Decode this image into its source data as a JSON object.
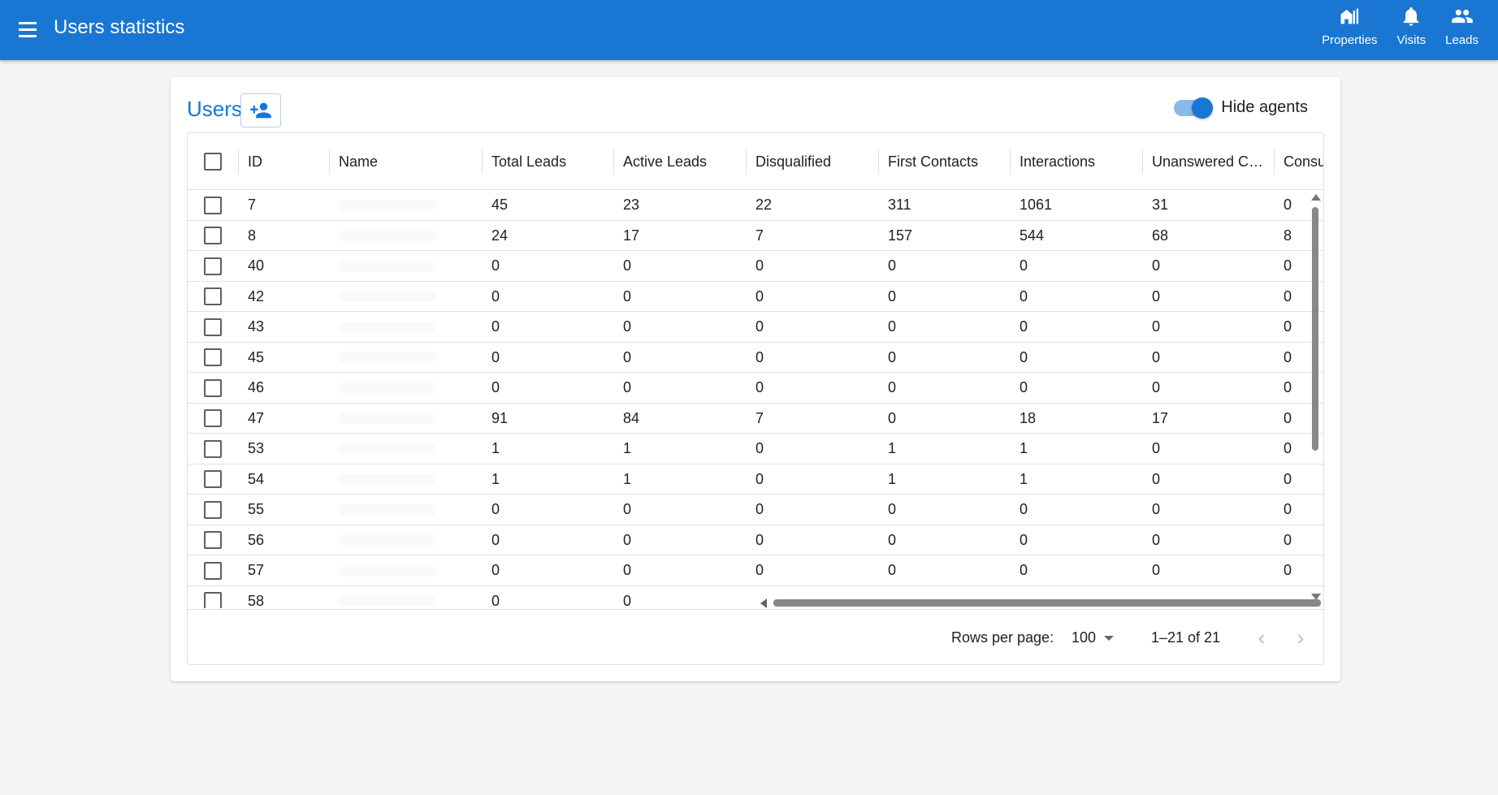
{
  "appbar": {
    "title": "Users statistics",
    "menu_icon": "menu-icon",
    "nav": [
      {
        "label": "Properties",
        "icon": "properties-icon"
      },
      {
        "label": "Visits",
        "icon": "bell-icon"
      },
      {
        "label": "Leads",
        "icon": "people-icon"
      }
    ],
    "color": "#1976d2"
  },
  "card": {
    "title": "Users",
    "add_user_icon": "add-user-icon",
    "toggle": {
      "label": "Hide agents",
      "checked": true
    }
  },
  "table": {
    "columns": [
      "ID",
      "Name",
      "Total Leads",
      "Active Leads",
      "Disqualified",
      "First Contacts",
      "Interactions",
      "Unanswered C…",
      "Consu"
    ],
    "rows": [
      [
        "7",
        "",
        "45",
        "23",
        "22",
        "311",
        "1061",
        "31",
        "0"
      ],
      [
        "8",
        "",
        "24",
        "17",
        "7",
        "157",
        "544",
        "68",
        "8"
      ],
      [
        "40",
        "",
        "0",
        "0",
        "0",
        "0",
        "0",
        "0",
        "0"
      ],
      [
        "42",
        "",
        "0",
        "0",
        "0",
        "0",
        "0",
        "0",
        "0"
      ],
      [
        "43",
        "",
        "0",
        "0",
        "0",
        "0",
        "0",
        "0",
        "0"
      ],
      [
        "45",
        "",
        "0",
        "0",
        "0",
        "0",
        "0",
        "0",
        "0"
      ],
      [
        "46",
        "",
        "0",
        "0",
        "0",
        "0",
        "0",
        "0",
        "0"
      ],
      [
        "47",
        "",
        "91",
        "84",
        "7",
        "0",
        "18",
        "17",
        "0"
      ],
      [
        "53",
        "",
        "1",
        "1",
        "0",
        "1",
        "1",
        "0",
        "0"
      ],
      [
        "54",
        "",
        "1",
        "1",
        "0",
        "1",
        "1",
        "0",
        "0"
      ],
      [
        "55",
        "",
        "0",
        "0",
        "0",
        "0",
        "0",
        "0",
        "0"
      ],
      [
        "56",
        "",
        "0",
        "0",
        "0",
        "0",
        "0",
        "0",
        "0"
      ],
      [
        "57",
        "",
        "0",
        "0",
        "0",
        "0",
        "0",
        "0",
        "0"
      ],
      [
        "58",
        "",
        "0",
        "0",
        "",
        "",
        "",
        "",
        ""
      ]
    ]
  },
  "footer": {
    "rows_per_page_label": "Rows per page:",
    "rows_per_page_value": "100",
    "page_range": "1–21 of 21",
    "prev_icon": "chevron-left-icon",
    "next_icon": "chevron-right-icon"
  }
}
